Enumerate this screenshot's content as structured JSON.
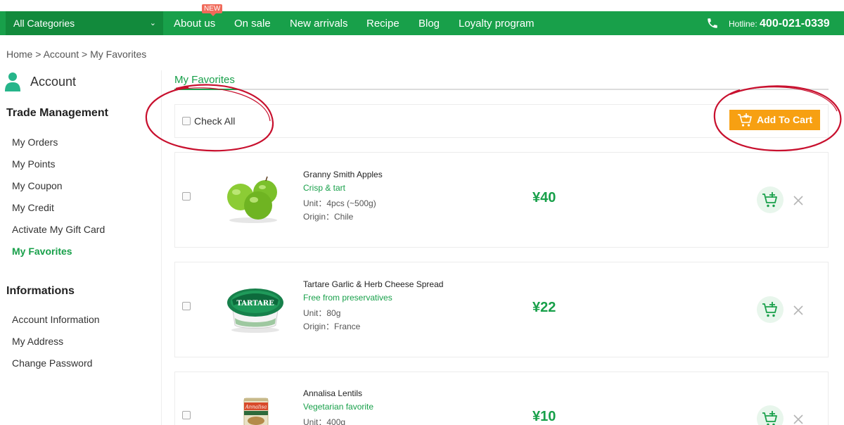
{
  "topnav": {
    "category_label": "All Categories",
    "items": [
      {
        "label": "About us"
      },
      {
        "label": "On sale"
      },
      {
        "label": "New arrivals"
      },
      {
        "label": "Recipe"
      },
      {
        "label": "Blog"
      },
      {
        "label": "Loyalty program"
      }
    ],
    "new_badge": "NEW",
    "hotline_label": "Hotline:",
    "hotline_number": "400-021-0339"
  },
  "breadcrumb": {
    "home": "Home",
    "sep1": ">",
    "account": "Account",
    "sep2": ">",
    "current": "My Favorites"
  },
  "sidebar": {
    "title": "Account",
    "sections": [
      {
        "heading": "Trade Management",
        "items": [
          {
            "label": "My Orders"
          },
          {
            "label": "My Points"
          },
          {
            "label": "My Coupon"
          },
          {
            "label": "My Credit"
          },
          {
            "label": "Activate My Gift Card"
          },
          {
            "label": "My Favorites"
          }
        ]
      },
      {
        "heading": "Informations",
        "items": [
          {
            "label": "Account Information"
          },
          {
            "label": "My Address"
          },
          {
            "label": "Change Password"
          }
        ]
      }
    ]
  },
  "main": {
    "tab_label": "My Favorites",
    "check_all_label": "Check All",
    "add_to_cart_label": "Add To Cart",
    "products": [
      {
        "name": "Granny Smith Apples",
        "tag": "Crisp & tart",
        "unit": "Unit：4pcs (~500g)",
        "origin": "Origin：Chile",
        "price": "¥40"
      },
      {
        "name": "Tartare Garlic & Herb Cheese Spread",
        "tag": "Free from preservatives",
        "unit": "Unit：80g",
        "origin": "Origin：France",
        "price": "¥22"
      },
      {
        "name": "Annalisa Lentils",
        "tag": "Vegetarian favorite",
        "unit": "Unit：400g",
        "origin": "",
        "price": "¥10"
      }
    ]
  },
  "product_image_text": {
    "tartare_lid": "TARTARE",
    "annalisa_label": "Annalisa"
  },
  "colors": {
    "brand_green": "#18a04a",
    "accent_orange": "#f7a012",
    "annotation_red": "#c8102e"
  }
}
